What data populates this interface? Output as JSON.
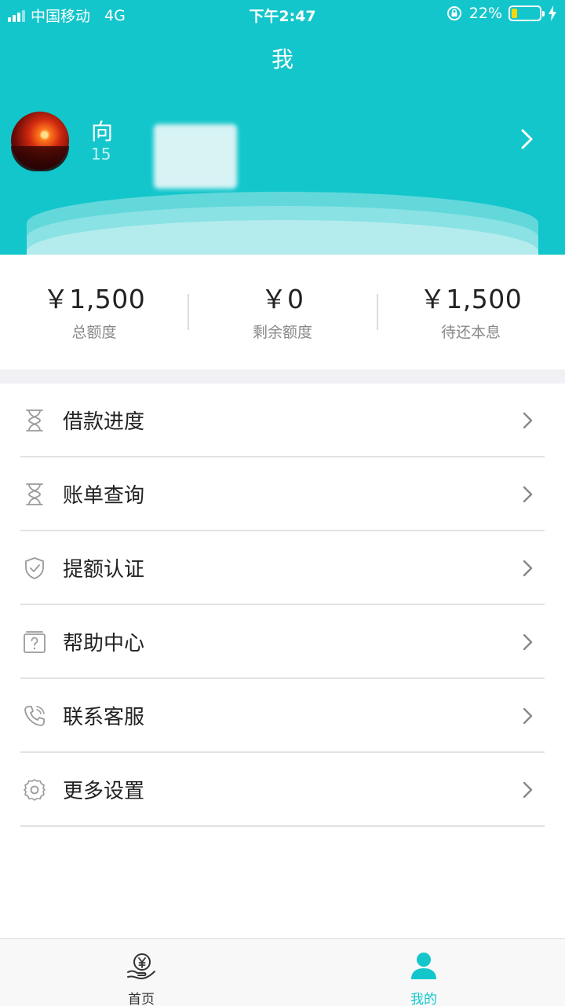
{
  "status_bar": {
    "carrier": "中国移动",
    "network": "4G",
    "time": "下午2:47",
    "battery": "22%",
    "battery_level": 0.22
  },
  "header": {
    "title": "我"
  },
  "profile": {
    "name": "向",
    "phone": "15"
  },
  "stats": [
    {
      "value": "￥1,500",
      "label": "总额度"
    },
    {
      "value": "￥0",
      "label": "剩余额度"
    },
    {
      "value": "￥1,500",
      "label": "待还本息"
    }
  ],
  "menu": [
    {
      "label": "借款进度",
      "icon": "hourglass-icon"
    },
    {
      "label": "账单查询",
      "icon": "hourglass-icon"
    },
    {
      "label": "提额认证",
      "icon": "shield-check-icon"
    },
    {
      "label": "帮助中心",
      "icon": "help-box-icon"
    },
    {
      "label": "联系客服",
      "icon": "phone-icon"
    },
    {
      "label": "更多设置",
      "icon": "gear-icon"
    }
  ],
  "tabbar": [
    {
      "label": "首页",
      "icon": "yen-hand-icon",
      "active": false
    },
    {
      "label": "我的",
      "icon": "person-icon",
      "active": true
    }
  ],
  "colors": {
    "accent": "#13c6cb",
    "text": "#222222",
    "muted": "#888888"
  }
}
